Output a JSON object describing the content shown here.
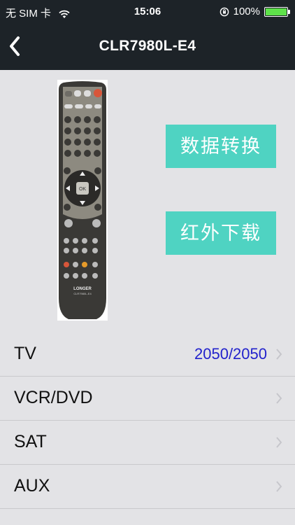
{
  "status_bar": {
    "carrier": "无 SIM 卡",
    "time": "15:06",
    "battery": "100%",
    "battery_color": "#5ee24a"
  },
  "nav": {
    "title": "CLR7980L-E4",
    "back_icon": "chevron-left-icon"
  },
  "remote_image": {
    "brand_text": "LONGER",
    "model_text": "CLR7980L-E4"
  },
  "actions": {
    "data_convert": "数据转换",
    "ir_download": "红外下载",
    "accent_color": "#4fd3c2"
  },
  "devices": [
    {
      "label": "TV",
      "value": "2050/2050"
    },
    {
      "label": "VCR/DVD",
      "value": ""
    },
    {
      "label": "SAT",
      "value": ""
    },
    {
      "label": "AUX",
      "value": ""
    }
  ]
}
